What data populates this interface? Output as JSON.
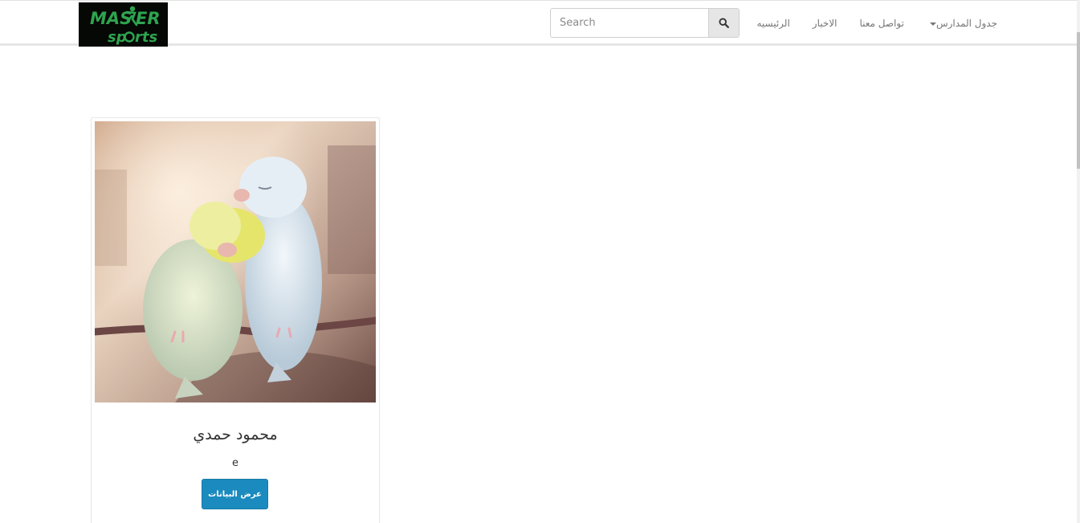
{
  "header": {
    "logo": {
      "text_top": "MASTER",
      "text_bottom": "sports",
      "colors": {
        "background": "#050805",
        "green": "#2ea44f",
        "dark_green": "#14752e"
      }
    },
    "search": {
      "placeholder": "Search",
      "icon": "search-icon"
    },
    "nav": {
      "items": [
        {
          "label": "جدول المدارس",
          "has_dropdown": true
        },
        {
          "label": "تواصل معنا"
        },
        {
          "label": "الاخبار"
        },
        {
          "label": "الرئيسيه"
        }
      ]
    }
  },
  "card": {
    "image": {
      "subject": "two budgies cuddling on a branch"
    },
    "name": "محمود حمدي",
    "description": "e",
    "button_label": "عرض البيانات",
    "colors": {
      "button": "#1b8bbf"
    }
  }
}
